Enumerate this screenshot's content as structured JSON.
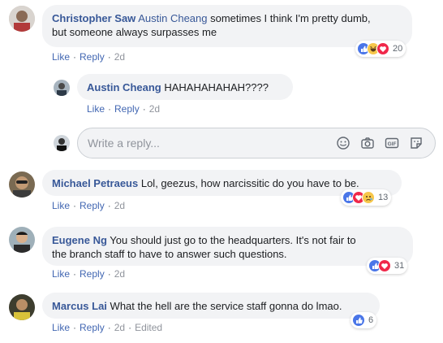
{
  "comments": [
    {
      "author": "Christopher Saw",
      "mention": "Austin Cheang",
      "text": " sometimes I think I'm pretty dumb,",
      "text2": "but someone always surpasses me",
      "like": "Like",
      "reply": "Reply",
      "time": "2d",
      "reactions": {
        "icons": [
          "like-icon",
          "haha-icon",
          "love-icon"
        ],
        "count": "20"
      }
    },
    {
      "author": "Austin Cheang",
      "text": "HAHAHAHAHAH????",
      "like": "Like",
      "reply": "Reply",
      "time": "2d"
    },
    {
      "author": "Michael Petraeus",
      "text": "Lol, geezus, how narcissitic do you have to be.",
      "like": "Like",
      "reply": "Reply",
      "time": "2d",
      "reactions": {
        "icons": [
          "like-icon",
          "love-icon",
          "sad-icon"
        ],
        "count": "13"
      }
    },
    {
      "author": "Eugene Ng",
      "text": "You should just go to the headquarters. It's not fair to",
      "text2": "the branch staff to have to answer such questions.",
      "like": "Like",
      "reply": "Reply",
      "time": "2d",
      "reactions": {
        "icons": [
          "like-icon",
          "love-icon"
        ],
        "count": "31"
      }
    },
    {
      "author": "Marcus Lai",
      "text": "What the hell are the service staff gonna do lmao.",
      "like": "Like",
      "reply": "Reply",
      "time": "2d",
      "edited": "Edited",
      "reactions": {
        "icons": [
          "like-icon"
        ],
        "count": "6"
      }
    }
  ],
  "reply_box": {
    "placeholder": "Write a reply...",
    "icons": [
      "emoji-icon",
      "camera-icon",
      "gif-icon",
      "sticker-icon"
    ]
  },
  "colors": {
    "name": "#385898",
    "link": "#4267b2",
    "bubble": "#f2f3f5",
    "like": "#4a76e8",
    "love": "#f0284a",
    "haha": "#f7c74a"
  }
}
